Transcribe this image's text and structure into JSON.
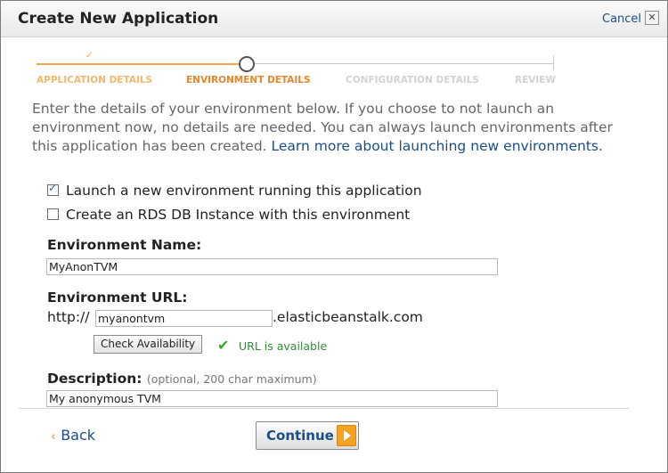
{
  "dialog": {
    "title": "Create New Application",
    "cancel_label": "Cancel",
    "close_glyph": "✕"
  },
  "stepper": {
    "steps": [
      {
        "label": "APPLICATION DETAILS",
        "state": "complete"
      },
      {
        "label": "ENVIRONMENT DETAILS",
        "state": "current"
      },
      {
        "label": "CONFIGURATION DETAILS",
        "state": "pending"
      },
      {
        "label": "REVIEW",
        "state": "pending"
      }
    ],
    "complete_mark": "✓",
    "active_color": "#e8862a"
  },
  "intro": {
    "text": "Enter the details of your environment below. If you choose to not launch an environment now, no details are needed. You can always launch environments after this application has been created. ",
    "link_text": "Learn more about launching new environments."
  },
  "options": {
    "launch_env": {
      "label": "Launch a new environment running this application",
      "checked": true
    },
    "create_rds": {
      "label": "Create an RDS DB Instance with this environment",
      "checked": false
    }
  },
  "form": {
    "env_name": {
      "label": "Environment Name:",
      "value": "MyAnonTVM"
    },
    "env_url": {
      "label": "Environment URL:",
      "prefix": "http://",
      "value": "myanontvm",
      "suffix": ".elasticbeanstalk.com",
      "check_button": "Check Availability",
      "status_icon": "checkmark-icon",
      "status_text": "URL is available"
    },
    "description": {
      "label": "Description:",
      "hint": "(optional, 200 char maximum)",
      "value": "My anonymous TVM"
    }
  },
  "footer": {
    "back_label": "Back",
    "back_glyph": "‹",
    "continue_label": "Continue"
  },
  "colors": {
    "link": "#1a4e8a",
    "accent": "#f4a21f",
    "success": "#3aa331"
  }
}
